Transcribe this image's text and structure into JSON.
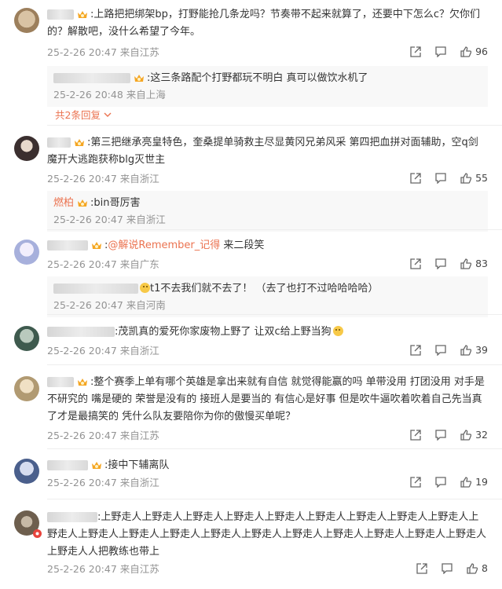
{
  "comments": [
    {
      "text": ":上路把把绑架bp，打野能抢几条龙吗？节奏带不起来就算了，还要中下怎么c？欠你们的？解散吧，没什么希望了今年。",
      "meta": "25-2-26 20:47 来自江苏",
      "likes": "96",
      "reply": {
        "text": ":这三条路配个打野都玩不明白 真可以做饮水机了",
        "meta": "25-2-26 20:48 来自上海"
      },
      "more": "共2条回复",
      "avatar_color": "#b79a78"
    },
    {
      "text": ":第三把继承亮皇特色，奎桑提单骑救主尽显黄冈兄弟风采 第四把血拼对面辅助，空q剑魔开大逃跑获称blg灭世主",
      "meta": "25-2-26 20:47 来自浙江",
      "likes": "55",
      "reply": {
        "name": "燃柏",
        "text": ":bin哥厉害",
        "meta": "25-2-26 20:47 来自浙江"
      },
      "avatar_color": "#5a4a4a"
    },
    {
      "text_prefix": ":",
      "mention": "@解说Remember_记得",
      "text_suffix": " 来二段笑",
      "meta": "25-2-26 20:47 来自广东",
      "likes": "83",
      "reply": {
        "text": "t1不去我们就不去了！ （去了也打不过哈哈哈哈）",
        "meta": "25-2-26 20:47 来自河南"
      },
      "avatar_color": "#c9cde8"
    },
    {
      "text": ":茂凯真的爱死你家废物上野了 让双c给上野当狗",
      "meta": "25-2-26 20:47 来自浙江",
      "likes": "39",
      "avatar_color": "#6c8a78"
    },
    {
      "text": ":整个赛季上单有哪个英雄是拿出来就有自信 就觉得能赢的吗 单带没用 打团没用 对手是不研究的 嘴是硬的 荣誉是没有的 接班人是要当的 有信心是好事 但是吹牛逼吹着吹着自己先当真了才是最搞笑的 凭什么队友要陪你为你的傲慢买单呢？",
      "meta": "25-2-26 20:47 来自江苏",
      "likes": "32",
      "avatar_color": "#c9b58c"
    },
    {
      "text": ":接中下辅离队",
      "meta": "25-2-26 20:47 来自浙江",
      "likes": "19",
      "avatar_color": "#6a7fa6"
    },
    {
      "text": ":上野走人上野走人上野走人上野走人上野走人上野走人上野走人上野走人上野走人上野走人上野走人上野走人上野走人上野走人上野走人上野走人上野走人上野走人上野走人上野走人上野走人人把教练也带上",
      "meta": "25-2-26 20:47 来自江苏",
      "likes": "8",
      "avatar_color": "#8a7a66"
    }
  ]
}
